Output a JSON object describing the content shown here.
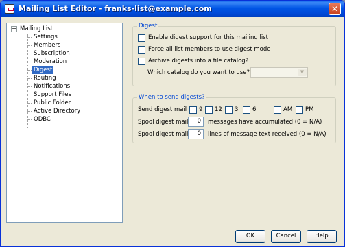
{
  "window": {
    "title": "Mailing List Editor - franks-list@example.com",
    "close_label": "✕"
  },
  "tree": {
    "root_label": "Mailing List",
    "expander": "−",
    "items": [
      "Settings",
      "Members",
      "Subscription",
      "Moderation",
      "Digest",
      "Routing",
      "Notifications",
      "Support Files",
      "Public Folder",
      "Active Directory",
      "ODBC"
    ],
    "selected": "Digest"
  },
  "digest": {
    "title": "Digest",
    "enable_label": "Enable digest support for this mailing list",
    "force_label": "Force all list members to use digest mode",
    "archive_label": "Archive digests into a file catalog?",
    "catalog_question": "Which catalog do you want to use?",
    "catalog_value": ""
  },
  "when": {
    "title": "When to send digests?",
    "send_label": "Send digest mail at",
    "hours": [
      "9",
      "12",
      "3",
      "6"
    ],
    "am_label": "AM",
    "pm_label": "PM",
    "spool1_prefix": "Spool digest mail if",
    "spool1_value": "0",
    "spool1_suffix": "messages have accumulated (0 = N/A)",
    "spool2_prefix": "Spool digest mail if",
    "spool2_value": "0",
    "spool2_suffix": "lines of message text received (0 = N/A)"
  },
  "buttons": {
    "ok": "OK",
    "cancel": "Cancel",
    "help": "Help"
  }
}
